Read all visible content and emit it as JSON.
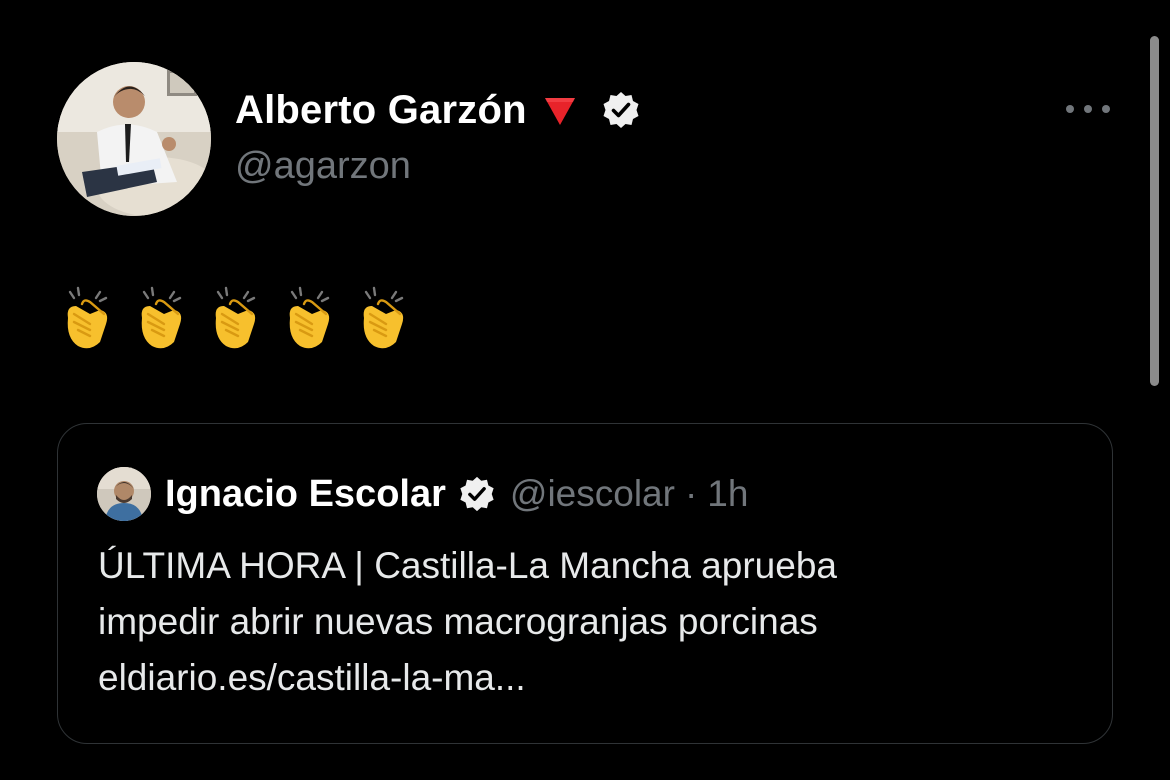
{
  "tweet": {
    "author": {
      "name": "Alberto Garzón",
      "handle": "@agarzon"
    },
    "body": {
      "emoji": [
        "👏",
        "👏",
        "👏",
        "👏",
        "👏"
      ]
    },
    "quoted": {
      "author_name": "Ignacio Escolar",
      "handle": "@iescolar",
      "separator": "·",
      "time": "1h",
      "lines": [
        "ÚLTIMA HORA | Castilla-La Mancha aprueba",
        "impedir abrir nuevas macrogranjas porcinas",
        "eldiario.es/castilla-la-ma..."
      ]
    }
  },
  "icons": {
    "author_badge": "red-triangle-icon",
    "verified": "verified-badge-icon",
    "more": "more-options-icon"
  },
  "colors": {
    "background": "#000000",
    "primary_text": "#e7e9ea",
    "secondary_text": "#71767b",
    "border": "#2f3336",
    "triangle": "#e8232a",
    "clap": "#f7c02d"
  }
}
